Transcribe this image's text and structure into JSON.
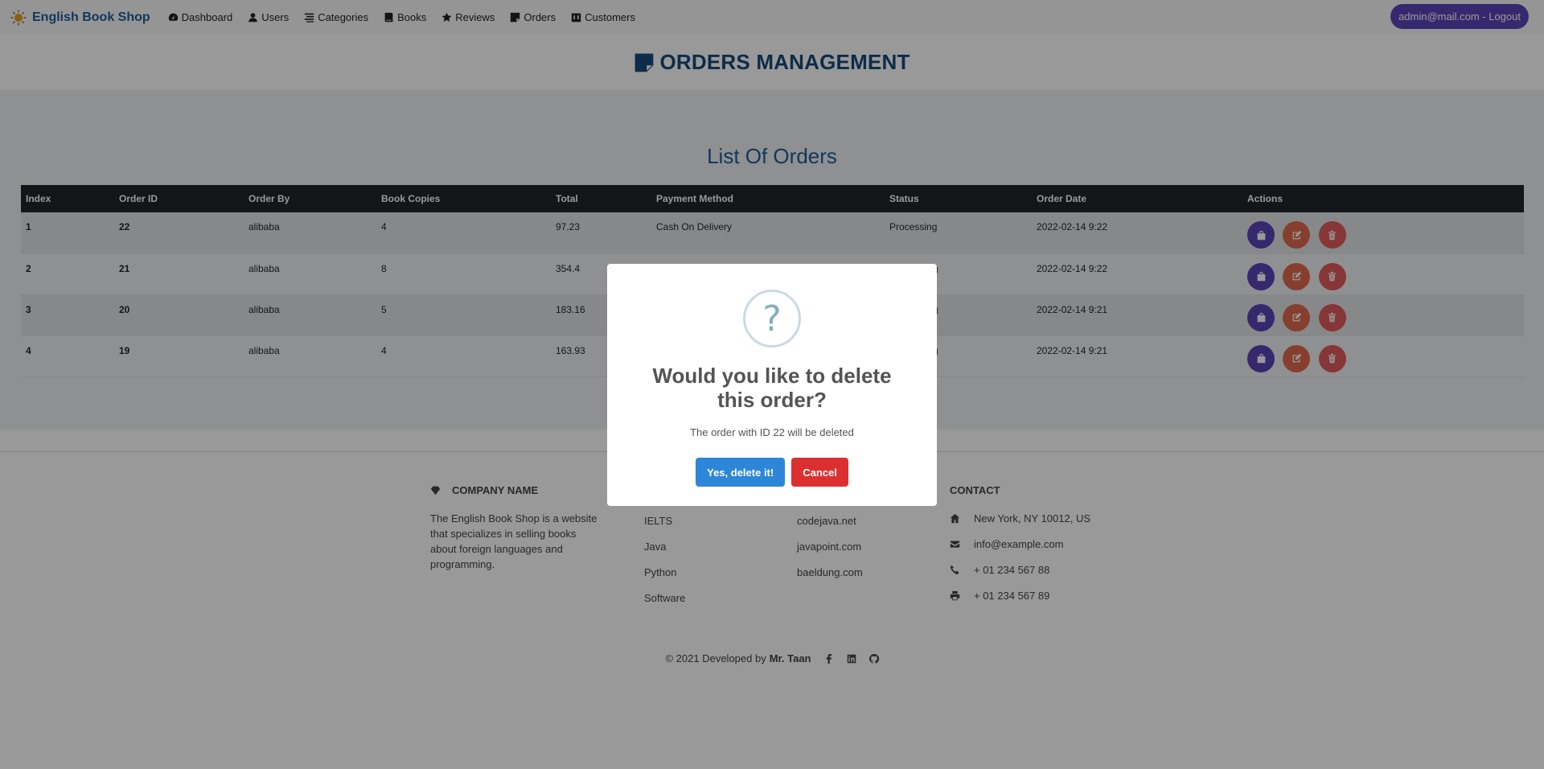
{
  "nav": {
    "brand": "English Book Shop",
    "items": [
      {
        "label": "Dashboard",
        "icon": "dashboard-icon"
      },
      {
        "label": "Users",
        "icon": "user-icon"
      },
      {
        "label": "Categories",
        "icon": "list-icon"
      },
      {
        "label": "Books",
        "icon": "book-icon"
      },
      {
        "label": "Reviews",
        "icon": "star-icon"
      },
      {
        "label": "Orders",
        "icon": "note-icon"
      },
      {
        "label": "Customers",
        "icon": "customers-icon"
      }
    ],
    "logout": "admin@mail.com - Logout"
  },
  "header": {
    "title": "ORDERS MANAGEMENT"
  },
  "main": {
    "list_title": "List Of Orders",
    "columns": [
      "Index",
      "Order ID",
      "Order By",
      "Book Copies",
      "Total",
      "Payment Method",
      "Status",
      "Order Date",
      "Actions"
    ],
    "rows": [
      {
        "index": "1",
        "order_id": "22",
        "order_by": "alibaba",
        "copies": "4",
        "total": "97.23",
        "payment": "Cash On Delivery",
        "status": "Processing",
        "date": "2022-02-14 9:22"
      },
      {
        "index": "2",
        "order_id": "21",
        "order_by": "alibaba",
        "copies": "8",
        "total": "354.4",
        "payment": "",
        "status": "g",
        "date": "2022-02-14 9:22"
      },
      {
        "index": "3",
        "order_id": "20",
        "order_by": "alibaba",
        "copies": "5",
        "total": "183.16",
        "payment": "",
        "status": "g",
        "date": "2022-02-14 9:21"
      },
      {
        "index": "4",
        "order_id": "19",
        "order_by": "alibaba",
        "copies": "4",
        "total": "163.93",
        "payment": "",
        "status": "g",
        "date": "2022-02-14 9:21"
      }
    ]
  },
  "footer": {
    "company_title": "COMPANY NAME",
    "company_text": "The English Book Shop is a website that specializes in selling books about foreign languages and programming.",
    "categories": [
      "IELTS",
      "Java",
      "Python",
      "Software"
    ],
    "links": [
      "codejava.net",
      "javapoint.com",
      "baeldung.com"
    ],
    "contact_title": "CONTACT",
    "contact": {
      "address": "New York, NY 10012, US",
      "email": "info@example.com",
      "phone": "+ 01 234 567 88",
      "fax": "+ 01 234 567 89"
    },
    "copyright": "© 2021 Developed by",
    "author": "Mr. Taan"
  },
  "modal": {
    "icon": "?",
    "title": "Would you like to delete this order?",
    "text": "The order with ID 22 will be deleted",
    "confirm": "Yes, delete it!",
    "cancel": "Cancel"
  }
}
